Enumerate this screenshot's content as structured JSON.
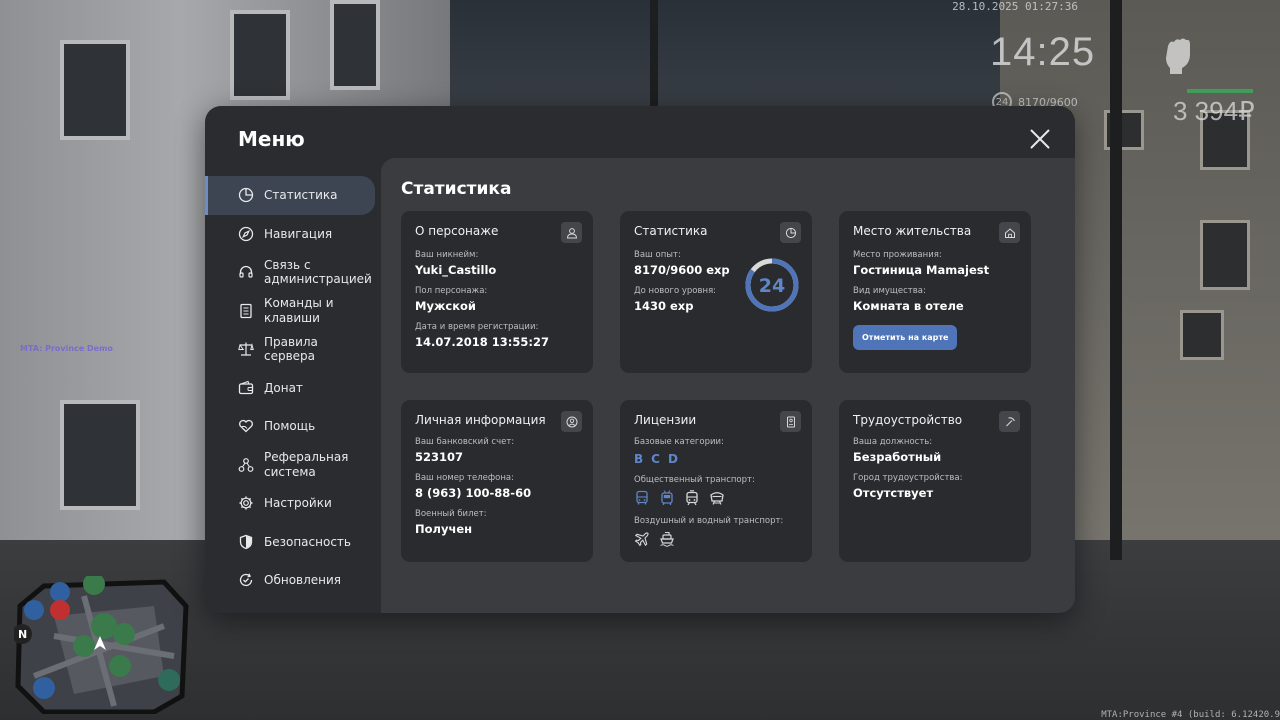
{
  "hud": {
    "datetime": "28.10.2025 01:27:36",
    "time": "14:25",
    "level": "24",
    "exp": "8170/9600",
    "money": "3 394₽",
    "server_label": "MTA: Province Demo",
    "build": "MTA:Province #4 (build: 6.12420.9"
  },
  "menu": {
    "title": "Меню",
    "sidebar": [
      {
        "label": "Статистика",
        "icon": "pie-chart-icon",
        "active": true
      },
      {
        "label": "Навигация",
        "icon": "compass-icon"
      },
      {
        "label": "Связь с администрацией",
        "icon": "headset-icon"
      },
      {
        "label": "Команды и клавиши",
        "icon": "document-icon"
      },
      {
        "label": "Правила сервера",
        "icon": "scales-icon"
      },
      {
        "label": "Донат",
        "icon": "wallet-icon"
      },
      {
        "label": "Помощь",
        "icon": "heart-hand-icon"
      },
      {
        "label": "Реферальная система",
        "icon": "network-icon"
      },
      {
        "label": "Настройки",
        "icon": "gear-icon"
      },
      {
        "label": "Безопасность",
        "icon": "shield-icon"
      },
      {
        "label": "Обновления",
        "icon": "refresh-check-icon"
      }
    ],
    "content_title": "Статистика",
    "character": {
      "title": "О персонаже",
      "nickname_label": "Ваш никнейм:",
      "nickname": "Yuki_Castillo",
      "gender_label": "Пол персонажа:",
      "gender": "Мужской",
      "reg_label": "Дата и время регистрации:",
      "reg": "14.07.2018 13:55:27"
    },
    "stats": {
      "title": "Статистика",
      "exp_label": "Ваш опыт:",
      "exp": "8170/9600 exp",
      "next_label": "До нового уровня:",
      "next": "1430 exp",
      "level": "24",
      "progress": 0.851
    },
    "residence": {
      "title": "Место жительства",
      "place_label": "Место проживания:",
      "place": "Гостиница Mamajest",
      "type_label": "Вид имущества:",
      "type": "Комната в отеле",
      "button": "Отметить на карте"
    },
    "personal": {
      "title": "Личная информация",
      "bank_label": "Ваш банковский счет:",
      "bank": "523107",
      "phone_label": "Ваш номер телефона:",
      "phone": "8 (963) 100-88-60",
      "military_label": "Военный билет:",
      "military": "Получен"
    },
    "licenses": {
      "title": "Лицензии",
      "base_label": "Базовые категории:",
      "categories": [
        "B",
        "C",
        "D"
      ],
      "public_label": "Общественный транспорт:",
      "air_label": "Воздушный и водный транспорт:"
    },
    "employment": {
      "title": "Трудоустройство",
      "position_label": "Ваша должность:",
      "position": "Безработный",
      "city_label": "Город трудоустройства:",
      "city": "Отсутствует"
    }
  },
  "colors": {
    "accent": "#4f75b8",
    "active_bar": "#6b8cc7",
    "ring_track": "#d9d9d9"
  }
}
